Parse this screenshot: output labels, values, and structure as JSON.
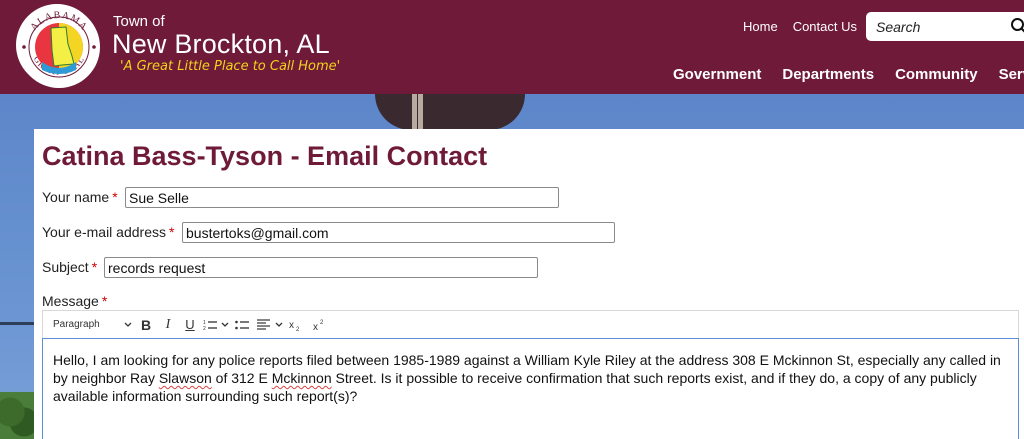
{
  "header": {
    "seal_top_text": "ALABAMA",
    "seal_bottom_text": "GREAT SEAL",
    "town_prefix": "Town of",
    "town_name": "New Brockton, AL",
    "tagline": "'A Great Little Place to Call Home'",
    "colors": {
      "brand": "#6e1a38",
      "tagline": "#f2d21b"
    }
  },
  "top_links": {
    "home": "Home",
    "contact": "Contact Us"
  },
  "search": {
    "placeholder": "Search",
    "icon": "search-icon"
  },
  "main_nav": {
    "government": "Government",
    "departments": "Departments",
    "community": "Community",
    "services": "Servi"
  },
  "form": {
    "title": "Catina Bass-Tyson - Email Contact",
    "name_label": "Your name",
    "name_value": "Sue Selle",
    "email_label": "Your e-mail address",
    "email_value": "bustertoks@gmail.com",
    "subject_label": "Subject",
    "subject_value": "records request",
    "message_label": "Message",
    "required_mark": "*",
    "editor": {
      "paragraph_style": "Paragraph",
      "bold": "B",
      "italic": "I",
      "underline": "U",
      "message_parts": [
        "Hello, I am looking for any police reports filed between 1985-1989 against a William Kyle Riley at the address 308 E Mckinnon St, especially any called in by neighbor Ray ",
        "Slawson",
        " of 312 E ",
        "Mckinnon",
        " Street. Is it possible to receive confirmation that such reports exist, and if they do, a copy of any publicly available information surrounding such report(s)?"
      ]
    }
  }
}
